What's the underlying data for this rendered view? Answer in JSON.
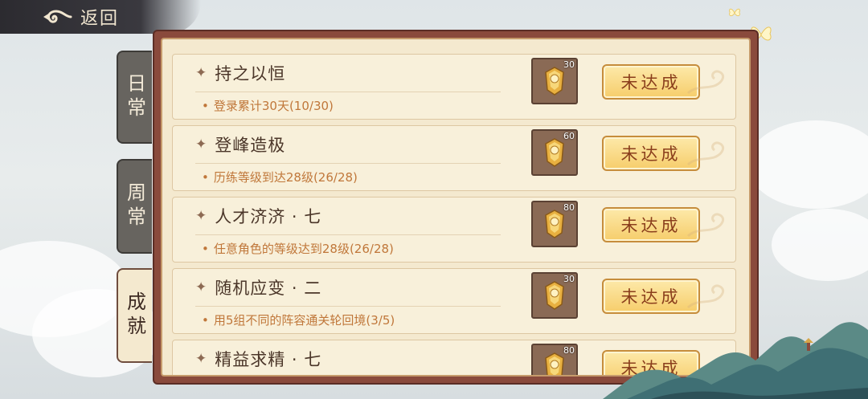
{
  "header": {
    "back_label": "返回"
  },
  "tabs": [
    {
      "label": "日常",
      "state": "inactive"
    },
    {
      "label": "周常",
      "state": "inactive"
    },
    {
      "label": "成就",
      "state": "active"
    }
  ],
  "tasks": [
    {
      "title": "持之以恒",
      "desc": "登录累计30天(10/30)",
      "reward_count": "30",
      "status": "未达成"
    },
    {
      "title": "登峰造极",
      "desc": "历练等级到达28级(26/28)",
      "reward_count": "60",
      "status": "未达成"
    },
    {
      "title": "人才济济 · 七",
      "desc": "任意角色的等级达到28级(26/28)",
      "reward_count": "80",
      "status": "未达成"
    },
    {
      "title": "随机应变 · 二",
      "desc": "用5组不同的阵容通关轮回境(3/5)",
      "reward_count": "30",
      "status": "未达成"
    },
    {
      "title": "精益求精 · 七",
      "desc": "",
      "reward_count": "80",
      "status": "未达成"
    }
  ],
  "colors": {
    "panel_border": "#8a4a3c",
    "panel_bg": "#f4e9cf",
    "button_gold": "#f6cd6b",
    "button_text": "#8a3e1c",
    "desc_orange": "#c0773a",
    "tab_gray": "#67645f"
  },
  "icons": [
    "back-swirl-icon",
    "four-point-star-icon",
    "gold-ingot-icon",
    "cloud-swirl-icon",
    "butterfly-icon"
  ]
}
